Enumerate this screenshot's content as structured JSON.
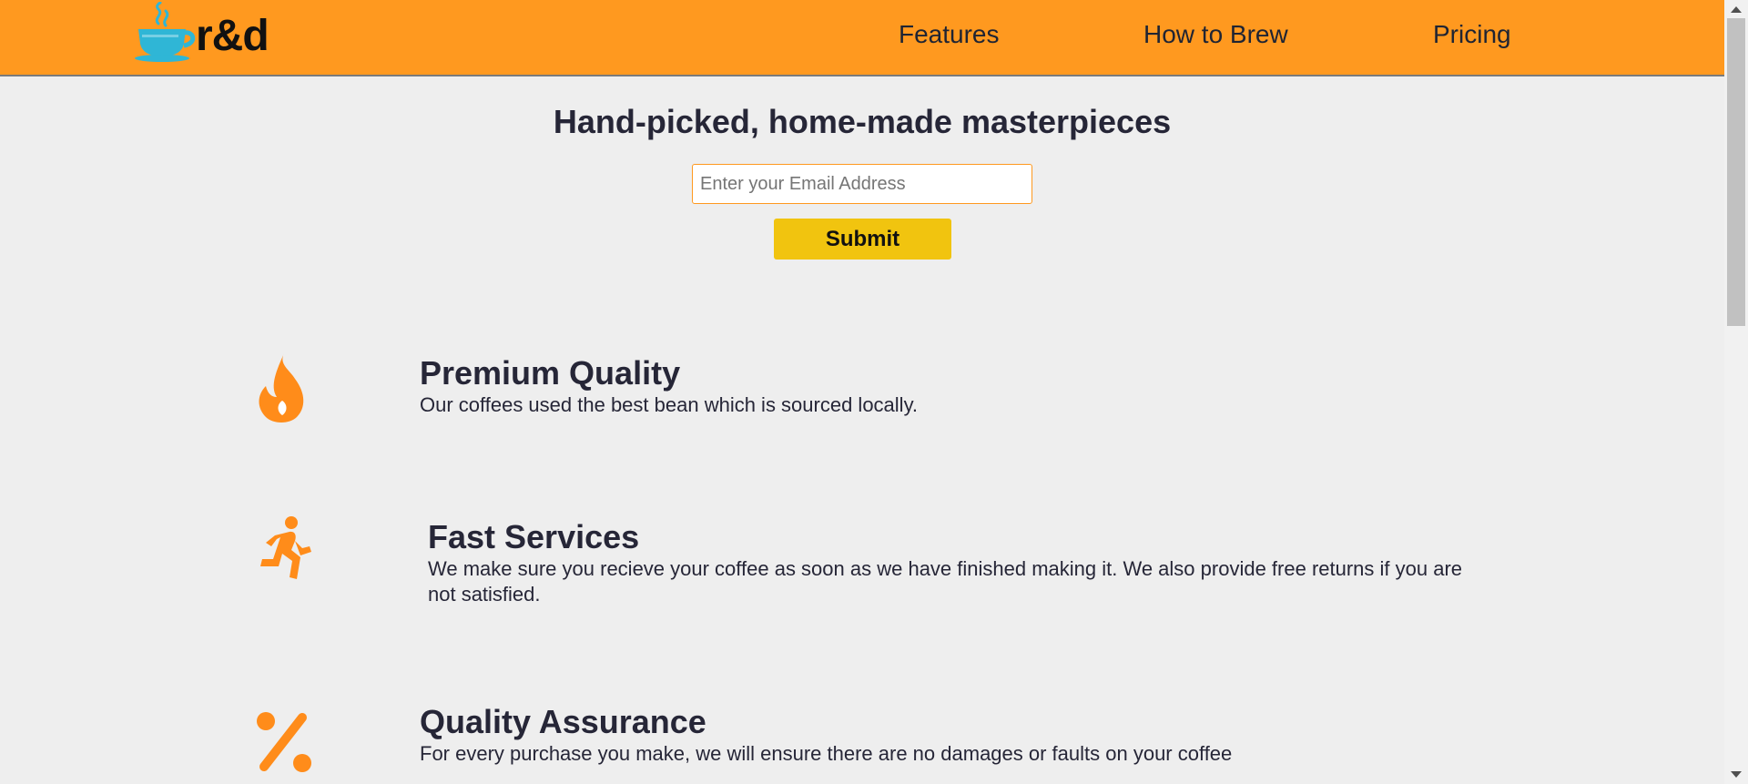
{
  "header": {
    "logo_text": "r&d",
    "logo_icon": "coffee-cup-icon",
    "nav": [
      {
        "label": "Features"
      },
      {
        "label": "How to Brew"
      },
      {
        "label": "Pricing"
      }
    ]
  },
  "hero": {
    "title": "Hand-picked, home-made masterpieces",
    "email_placeholder": "Enter your Email Address",
    "email_value": "",
    "submit_label": "Submit"
  },
  "features": [
    {
      "icon": "fire-icon",
      "title": "Premium Quality",
      "description": "Our coffees used the best bean which is sourced locally."
    },
    {
      "icon": "running-person-icon",
      "title": "Fast Services",
      "description": "We make sure you recieve your coffee as soon as we have finished making it. We also provide free returns if you are not satisfied."
    },
    {
      "icon": "percent-icon",
      "title": "Quality Assurance",
      "description": "For every purchase you make, we will ensure there are no damages or faults on your coffee"
    }
  ],
  "colors": {
    "header_bg": "#ff991f",
    "accent_icon": "#ff8c1a",
    "logo_icon": "#2fb6d6",
    "submit_bg": "#f1c40f",
    "page_bg": "#eeeeee",
    "text": "#262637"
  }
}
